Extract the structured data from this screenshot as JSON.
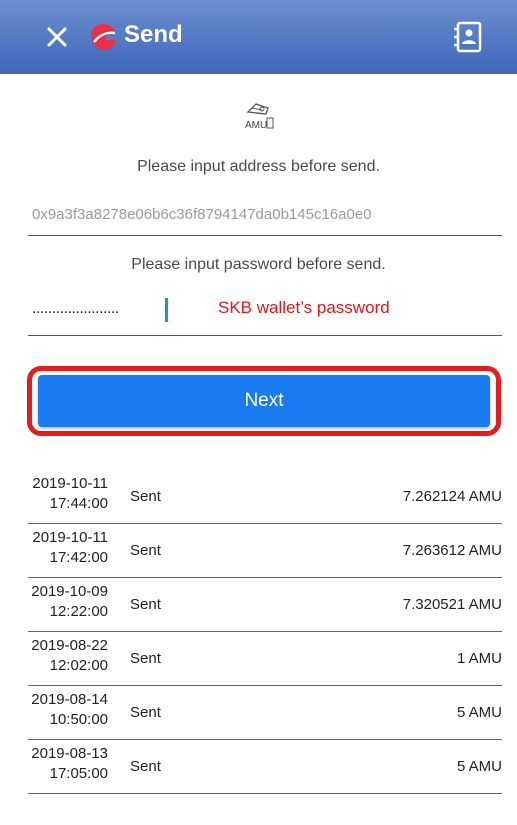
{
  "header": {
    "title": "Send",
    "close_icon": "close-icon",
    "contacts_icon": "contacts-icon"
  },
  "coin": {
    "icon": "amu-coin-icon",
    "label": "AMU"
  },
  "address": {
    "prompt": "Please input address before send.",
    "value": "0x9a3f3a8278e06b6c36f8794147da0b145c16a0e0"
  },
  "password": {
    "prompt": "Please input password before send.",
    "masked": "......................",
    "annotation": "SKB wallet’s password"
  },
  "next_label": "Next",
  "colors": {
    "appbar": "#4a72c0",
    "button": "#1a7bf0",
    "highlight": "#e61b1b",
    "annotation": "#e01818"
  },
  "transactions": [
    {
      "date": "2019-10-11",
      "time": "17:44:00",
      "status": "Sent",
      "amount": "7.262124 AMU"
    },
    {
      "date": "2019-10-11",
      "time": "17:42:00",
      "status": "Sent",
      "amount": "7.263612 AMU"
    },
    {
      "date": "2019-10-09",
      "time": "12:22:00",
      "status": "Sent",
      "amount": "7.320521 AMU"
    },
    {
      "date": "2019-08-22",
      "time": "12:02:00",
      "status": "Sent",
      "amount": "1 AMU"
    },
    {
      "date": "2019-08-14",
      "time": "10:50:00",
      "status": "Sent",
      "amount": "5 AMU"
    },
    {
      "date": "2019-08-13",
      "time": "17:05:00",
      "status": "Sent",
      "amount": "5 AMU"
    }
  ]
}
